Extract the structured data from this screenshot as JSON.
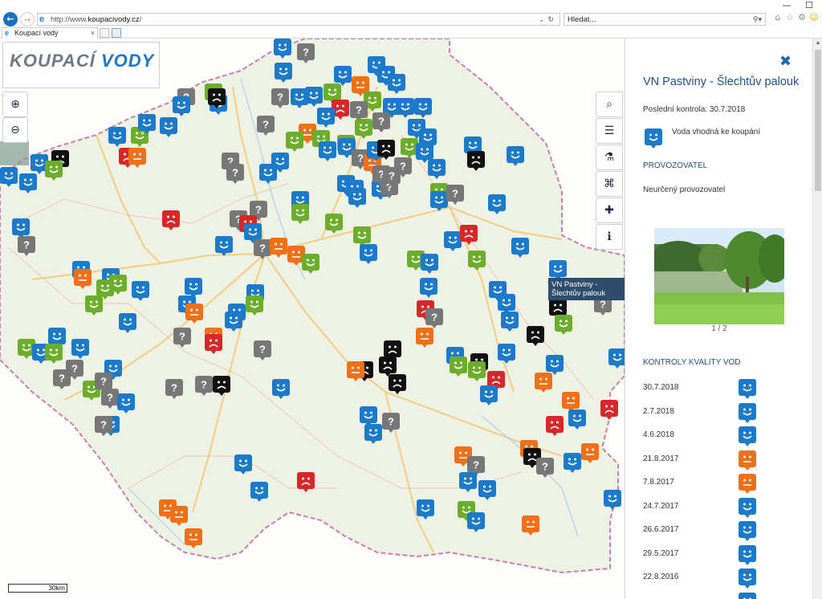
{
  "browser": {
    "url_prefix": "http://www.",
    "url_domain": "koupacivody.cz",
    "url_suffix": "/",
    "search_placeholder": "Hledat...",
    "tab_title": "Koupací vody"
  },
  "logo": {
    "part1": "KOUPACÍ ",
    "part2": "VODY"
  },
  "map": {
    "tooltip": "VN Pastviny - Šlechtův palouk",
    "scale": "30km",
    "zoom_in_icon": "zoom-in-icon",
    "zoom_out_icon": "zoom-out-icon",
    "colors": {
      "good": "#1b7ac9",
      "ok": "#6cae2c",
      "warn": "#f07018",
      "bad": "#d8262b",
      "closed": "#111111",
      "unknown": "#777777"
    }
  },
  "tools": [
    {
      "name": "search-tool-button",
      "icon": "search-icon",
      "glyph": "⌕"
    },
    {
      "name": "list-tool-button",
      "icon": "list-icon",
      "glyph": "☰"
    },
    {
      "name": "lab-tool-button",
      "icon": "flask-icon",
      "glyph": "⚗"
    },
    {
      "name": "link-tool-button",
      "icon": "link-icon",
      "glyph": "⌘"
    },
    {
      "name": "add-tool-button",
      "icon": "plus-icon",
      "glyph": "✚"
    },
    {
      "name": "info-tool-button",
      "icon": "info-icon",
      "glyph": "ℹ"
    }
  ],
  "panel": {
    "title": "VN Pastviny - Šlechtův palouk",
    "last_check": "Poslední kontrola: 30.7.2018",
    "status": "Voda vhodná ke koupání",
    "operator_heading": "PROVOZOVATEL",
    "operator": "Neurčený provozovatel",
    "photo_pager": "1 / 2",
    "checks_heading": "KONTROLY KVALITY VOD",
    "checks": [
      {
        "date": "30.7.2018",
        "status": "good"
      },
      {
        "date": "2.7.2018",
        "status": "good"
      },
      {
        "date": "4.6.2018",
        "status": "good"
      },
      {
        "date": "21.8.2017",
        "status": "warn"
      },
      {
        "date": "7.8.2017",
        "status": "warn"
      },
      {
        "date": "24.7.2017",
        "status": "good"
      },
      {
        "date": "26.6.2017",
        "status": "good"
      },
      {
        "date": "29.5.2017",
        "status": "good"
      },
      {
        "date": "22.8.2016",
        "status": "good"
      },
      {
        "date": "",
        "status": "good"
      }
    ]
  }
}
